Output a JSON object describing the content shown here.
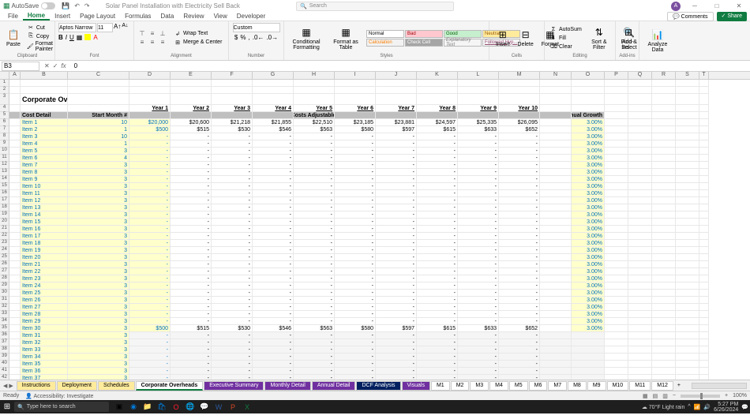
{
  "titlebar": {
    "autosave": "AutoSave",
    "filename": "Solar Panel Installation with Electricity Sell Back",
    "search_placeholder": "Search",
    "username": "",
    "avatar_initial": "A"
  },
  "tabs": {
    "file": "File",
    "home": "Home",
    "insert": "Insert",
    "pagelayout": "Page Layout",
    "formulas": "Formulas",
    "data": "Data",
    "review": "Review",
    "view": "View",
    "developer": "Developer",
    "comments": "Comments",
    "share": "Share"
  },
  "ribbon": {
    "clipboard": {
      "label": "Clipboard",
      "paste": "Paste",
      "cut": "Cut",
      "copy": "Copy",
      "format_painter": "Format Painter"
    },
    "font": {
      "label": "Font",
      "name": "Aptos Narrow",
      "size": "11"
    },
    "alignment": {
      "label": "Alignment",
      "wrap": "Wrap Text",
      "merge": "Merge & Center"
    },
    "number": {
      "label": "Number",
      "format": "Custom"
    },
    "styles": {
      "label": "Styles",
      "cond": "Conditional Formatting",
      "table": "Format as Table",
      "normal": "Normal",
      "bad": "Bad",
      "good": "Good",
      "neutral": "Neutral",
      "calculation": "Calculation",
      "check": "Check Cell",
      "explanatory": "Explanatory Text",
      "followed": "Followed Hyp..."
    },
    "cells": {
      "label": "Cells",
      "insert": "Insert",
      "delete": "Delete",
      "format": "Format"
    },
    "editing": {
      "label": "Editing",
      "autosum": "AutoSum",
      "fill": "Fill",
      "clear": "Clear",
      "sort": "Sort & Filter",
      "find": "Find & Select"
    },
    "addins": {
      "label": "Add-ins",
      "addins": "Add-ins"
    },
    "analyze": {
      "analyze": "Analyze Data"
    }
  },
  "formula": {
    "name_box": "B3",
    "fx": "fx",
    "value": "0"
  },
  "columns": [
    "A",
    "B",
    "C",
    "D",
    "E",
    "F",
    "G",
    "H",
    "I",
    "J",
    "K",
    "L",
    "M",
    "N",
    "O",
    "P",
    "Q",
    "R",
    "S",
    "T"
  ],
  "sheet": {
    "title": "Corporate Overheads Cost Schedule",
    "year_headers": [
      "Year 1",
      "Year 2",
      "Year 3",
      "Year 4",
      "Year 5",
      "Year 6",
      "Year 7",
      "Year 8",
      "Year 9",
      "Year 10"
    ],
    "cost_detail": "Cost Detail",
    "start_month": "Start Month #",
    "annual_costs_header": "Annual Costs Adjustable by Year",
    "annual_growth": "Annual Growth",
    "rows": [
      {
        "r": 6,
        "name": "Item 1",
        "month": "10",
        "vals": [
          "$20,000",
          "$20,600",
          "$21,218",
          "$21,855",
          "$22,510",
          "$23,185",
          "$23,881",
          "$24,597",
          "$25,335",
          "$26,095"
        ],
        "growth": "3.00%"
      },
      {
        "r": 7,
        "name": "Item 2",
        "month": "1",
        "vals": [
          "$500",
          "$515",
          "$530",
          "$546",
          "$563",
          "$580",
          "$597",
          "$615",
          "$633",
          "$652"
        ],
        "growth": "3.00%"
      },
      {
        "r": 8,
        "name": "Item 3",
        "month": "10",
        "vals": [
          "-",
          "-",
          "-",
          "-",
          "-",
          "-",
          "-",
          "-",
          "-",
          "-"
        ],
        "growth": "3.00%"
      },
      {
        "r": 9,
        "name": "Item 4",
        "month": "1",
        "vals": [
          "-",
          "-",
          "-",
          "-",
          "-",
          "-",
          "-",
          "-",
          "-",
          "-"
        ],
        "growth": "3.00%"
      },
      {
        "r": 10,
        "name": "Item 5",
        "month": "3",
        "vals": [
          "-",
          "-",
          "-",
          "-",
          "-",
          "-",
          "-",
          "-",
          "-",
          "-"
        ],
        "growth": "3.00%"
      },
      {
        "r": 11,
        "name": "Item 6",
        "month": "4",
        "vals": [
          "-",
          "-",
          "-",
          "-",
          "-",
          "-",
          "-",
          "-",
          "-",
          "-"
        ],
        "growth": "3.00%"
      },
      {
        "r": 12,
        "name": "Item 7",
        "month": "3",
        "vals": [
          "-",
          "-",
          "-",
          "-",
          "-",
          "-",
          "-",
          "-",
          "-",
          "-"
        ],
        "growth": "3.00%"
      },
      {
        "r": 13,
        "name": "Item 8",
        "month": "3",
        "vals": [
          "-",
          "-",
          "-",
          "-",
          "-",
          "-",
          "-",
          "-",
          "-",
          "-"
        ],
        "growth": "3.00%"
      },
      {
        "r": 14,
        "name": "Item 9",
        "month": "3",
        "vals": [
          "-",
          "-",
          "-",
          "-",
          "-",
          "-",
          "-",
          "-",
          "-",
          "-"
        ],
        "growth": "3.00%"
      },
      {
        "r": 15,
        "name": "Item 10",
        "month": "3",
        "vals": [
          "-",
          "-",
          "-",
          "-",
          "-",
          "-",
          "-",
          "-",
          "-",
          "-"
        ],
        "growth": "3.00%"
      },
      {
        "r": 16,
        "name": "Item 11",
        "month": "3",
        "vals": [
          "-",
          "-",
          "-",
          "-",
          "-",
          "-",
          "-",
          "-",
          "-",
          "-"
        ],
        "growth": "3.00%"
      },
      {
        "r": 17,
        "name": "Item 12",
        "month": "3",
        "vals": [
          "-",
          "-",
          "-",
          "-",
          "-",
          "-",
          "-",
          "-",
          "-",
          "-"
        ],
        "growth": "3.00%"
      },
      {
        "r": 18,
        "name": "Item 13",
        "month": "3",
        "vals": [
          "-",
          "-",
          "-",
          "-",
          "-",
          "-",
          "-",
          "-",
          "-",
          "-"
        ],
        "growth": "3.00%"
      },
      {
        "r": 19,
        "name": "Item 14",
        "month": "3",
        "vals": [
          "-",
          "-",
          "-",
          "-",
          "-",
          "-",
          "-",
          "-",
          "-",
          "-"
        ],
        "growth": "3.00%"
      },
      {
        "r": 20,
        "name": "Item 15",
        "month": "3",
        "vals": [
          "-",
          "-",
          "-",
          "-",
          "-",
          "-",
          "-",
          "-",
          "-",
          "-"
        ],
        "growth": "3.00%"
      },
      {
        "r": 21,
        "name": "Item 16",
        "month": "3",
        "vals": [
          "-",
          "-",
          "-",
          "-",
          "-",
          "-",
          "-",
          "-",
          "-",
          "-"
        ],
        "growth": "3.00%"
      },
      {
        "r": 22,
        "name": "Item 17",
        "month": "3",
        "vals": [
          "-",
          "-",
          "-",
          "-",
          "-",
          "-",
          "-",
          "-",
          "-",
          "-"
        ],
        "growth": "3.00%"
      },
      {
        "r": 23,
        "name": "Item 18",
        "month": "3",
        "vals": [
          "-",
          "-",
          "-",
          "-",
          "-",
          "-",
          "-",
          "-",
          "-",
          "-"
        ],
        "growth": "3.00%"
      },
      {
        "r": 24,
        "name": "Item 19",
        "month": "3",
        "vals": [
          "-",
          "-",
          "-",
          "-",
          "-",
          "-",
          "-",
          "-",
          "-",
          "-"
        ],
        "growth": "3.00%"
      },
      {
        "r": 25,
        "name": "Item 20",
        "month": "3",
        "vals": [
          "-",
          "-",
          "-",
          "-",
          "-",
          "-",
          "-",
          "-",
          "-",
          "-"
        ],
        "growth": "3.00%"
      },
      {
        "r": 26,
        "name": "Item 21",
        "month": "3",
        "vals": [
          "-",
          "-",
          "-",
          "-",
          "-",
          "-",
          "-",
          "-",
          "-",
          "-"
        ],
        "growth": "3.00%"
      },
      {
        "r": 27,
        "name": "Item 22",
        "month": "3",
        "vals": [
          "-",
          "-",
          "-",
          "-",
          "-",
          "-",
          "-",
          "-",
          "-",
          "-"
        ],
        "growth": "3.00%"
      },
      {
        "r": 28,
        "name": "Item 23",
        "month": "3",
        "vals": [
          "-",
          "-",
          "-",
          "-",
          "-",
          "-",
          "-",
          "-",
          "-",
          "-"
        ],
        "growth": "3.00%"
      },
      {
        "r": 29,
        "name": "Item 24",
        "month": "3",
        "vals": [
          "-",
          "-",
          "-",
          "-",
          "-",
          "-",
          "-",
          "-",
          "-",
          "-"
        ],
        "growth": "3.00%"
      },
      {
        "r": 30,
        "name": "Item 25",
        "month": "3",
        "vals": [
          "-",
          "-",
          "-",
          "-",
          "-",
          "-",
          "-",
          "-",
          "-",
          "-"
        ],
        "growth": "3.00%"
      },
      {
        "r": 31,
        "name": "Item 26",
        "month": "3",
        "vals": [
          "-",
          "-",
          "-",
          "-",
          "-",
          "-",
          "-",
          "-",
          "-",
          "-"
        ],
        "growth": "3.00%"
      },
      {
        "r": 32,
        "name": "Item 27",
        "month": "3",
        "vals": [
          "-",
          "-",
          "-",
          "-",
          "-",
          "-",
          "-",
          "-",
          "-",
          "-"
        ],
        "growth": "3.00%"
      },
      {
        "r": 33,
        "name": "Item 28",
        "month": "3",
        "vals": [
          "-",
          "-",
          "-",
          "-",
          "-",
          "-",
          "-",
          "-",
          "-",
          "-"
        ],
        "growth": "3.00%"
      },
      {
        "r": 34,
        "name": "Item 29",
        "month": "3",
        "vals": [
          "-",
          "-",
          "-",
          "-",
          "-",
          "-",
          "-",
          "-",
          "-",
          "-"
        ],
        "growth": "3.00%"
      },
      {
        "r": 35,
        "name": "Item 30",
        "month": "3",
        "vals": [
          "$500",
          "$515",
          "$530",
          "$546",
          "$563",
          "$580",
          "$597",
          "$615",
          "$633",
          "$652"
        ],
        "growth": "3.00%"
      },
      {
        "r": 36,
        "name": "Item 31",
        "month": "3",
        "vals": [
          "-",
          "-",
          "-",
          "-",
          "-",
          "-",
          "-",
          "-",
          "-",
          "-"
        ],
        "growth": "",
        "out": true
      },
      {
        "r": 37,
        "name": "Item 32",
        "month": "3",
        "vals": [
          "-",
          "-",
          "-",
          "-",
          "-",
          "-",
          "-",
          "-",
          "-",
          "-"
        ],
        "growth": "",
        "out": true
      },
      {
        "r": 38,
        "name": "Item 33",
        "month": "3",
        "vals": [
          "-",
          "-",
          "-",
          "-",
          "-",
          "-",
          "-",
          "-",
          "-",
          "-"
        ],
        "growth": "",
        "out": true
      },
      {
        "r": 39,
        "name": "Item 34",
        "month": "3",
        "vals": [
          "-",
          "-",
          "-",
          "-",
          "-",
          "-",
          "-",
          "-",
          "-",
          "-"
        ],
        "growth": "",
        "out": true
      },
      {
        "r": 40,
        "name": "Item 35",
        "month": "3",
        "vals": [
          "-",
          "-",
          "-",
          "-",
          "-",
          "-",
          "-",
          "-",
          "-",
          "-"
        ],
        "growth": "",
        "out": true
      },
      {
        "r": 41,
        "name": "Item 36",
        "month": "3",
        "vals": [
          "-",
          "-",
          "-",
          "-",
          "-",
          "-",
          "-",
          "-",
          "-",
          "-"
        ],
        "growth": "",
        "out": true
      },
      {
        "r": 42,
        "name": "Item 37",
        "month": "3",
        "vals": [
          "-",
          "-",
          "-",
          "-",
          "-",
          "-",
          "-",
          "-",
          "-",
          "-"
        ],
        "growth": "",
        "out": true
      }
    ]
  },
  "sheet_tabs": [
    {
      "name": "Instructions",
      "c": "c-yellow"
    },
    {
      "name": "Deployment",
      "c": "c-yellow"
    },
    {
      "name": "Schedules",
      "c": "c-yellow"
    },
    {
      "name": "Corporate Overheads",
      "c": "active"
    },
    {
      "name": "Executive Summary",
      "c": "c-purple"
    },
    {
      "name": "Monthly Detail",
      "c": "c-purple"
    },
    {
      "name": "Annual Detail",
      "c": "c-purple"
    },
    {
      "name": "DCF Analysis",
      "c": "c-blue"
    },
    {
      "name": "Visuals",
      "c": "c-purple"
    },
    {
      "name": "M1"
    },
    {
      "name": "M2"
    },
    {
      "name": "M3"
    },
    {
      "name": "M4"
    },
    {
      "name": "M5"
    },
    {
      "name": "M6"
    },
    {
      "name": "M7"
    },
    {
      "name": "M8"
    },
    {
      "name": "M9"
    },
    {
      "name": "M10"
    },
    {
      "name": "M11"
    },
    {
      "name": "M12"
    }
  ],
  "status": {
    "ready": "Ready",
    "access": "Accessibility: Investigate",
    "zoom": "100%"
  },
  "taskbar": {
    "search": "Type here to search",
    "weather": "70°F  Light rain",
    "time": "5:27 PM",
    "date": "6/26/2024"
  }
}
